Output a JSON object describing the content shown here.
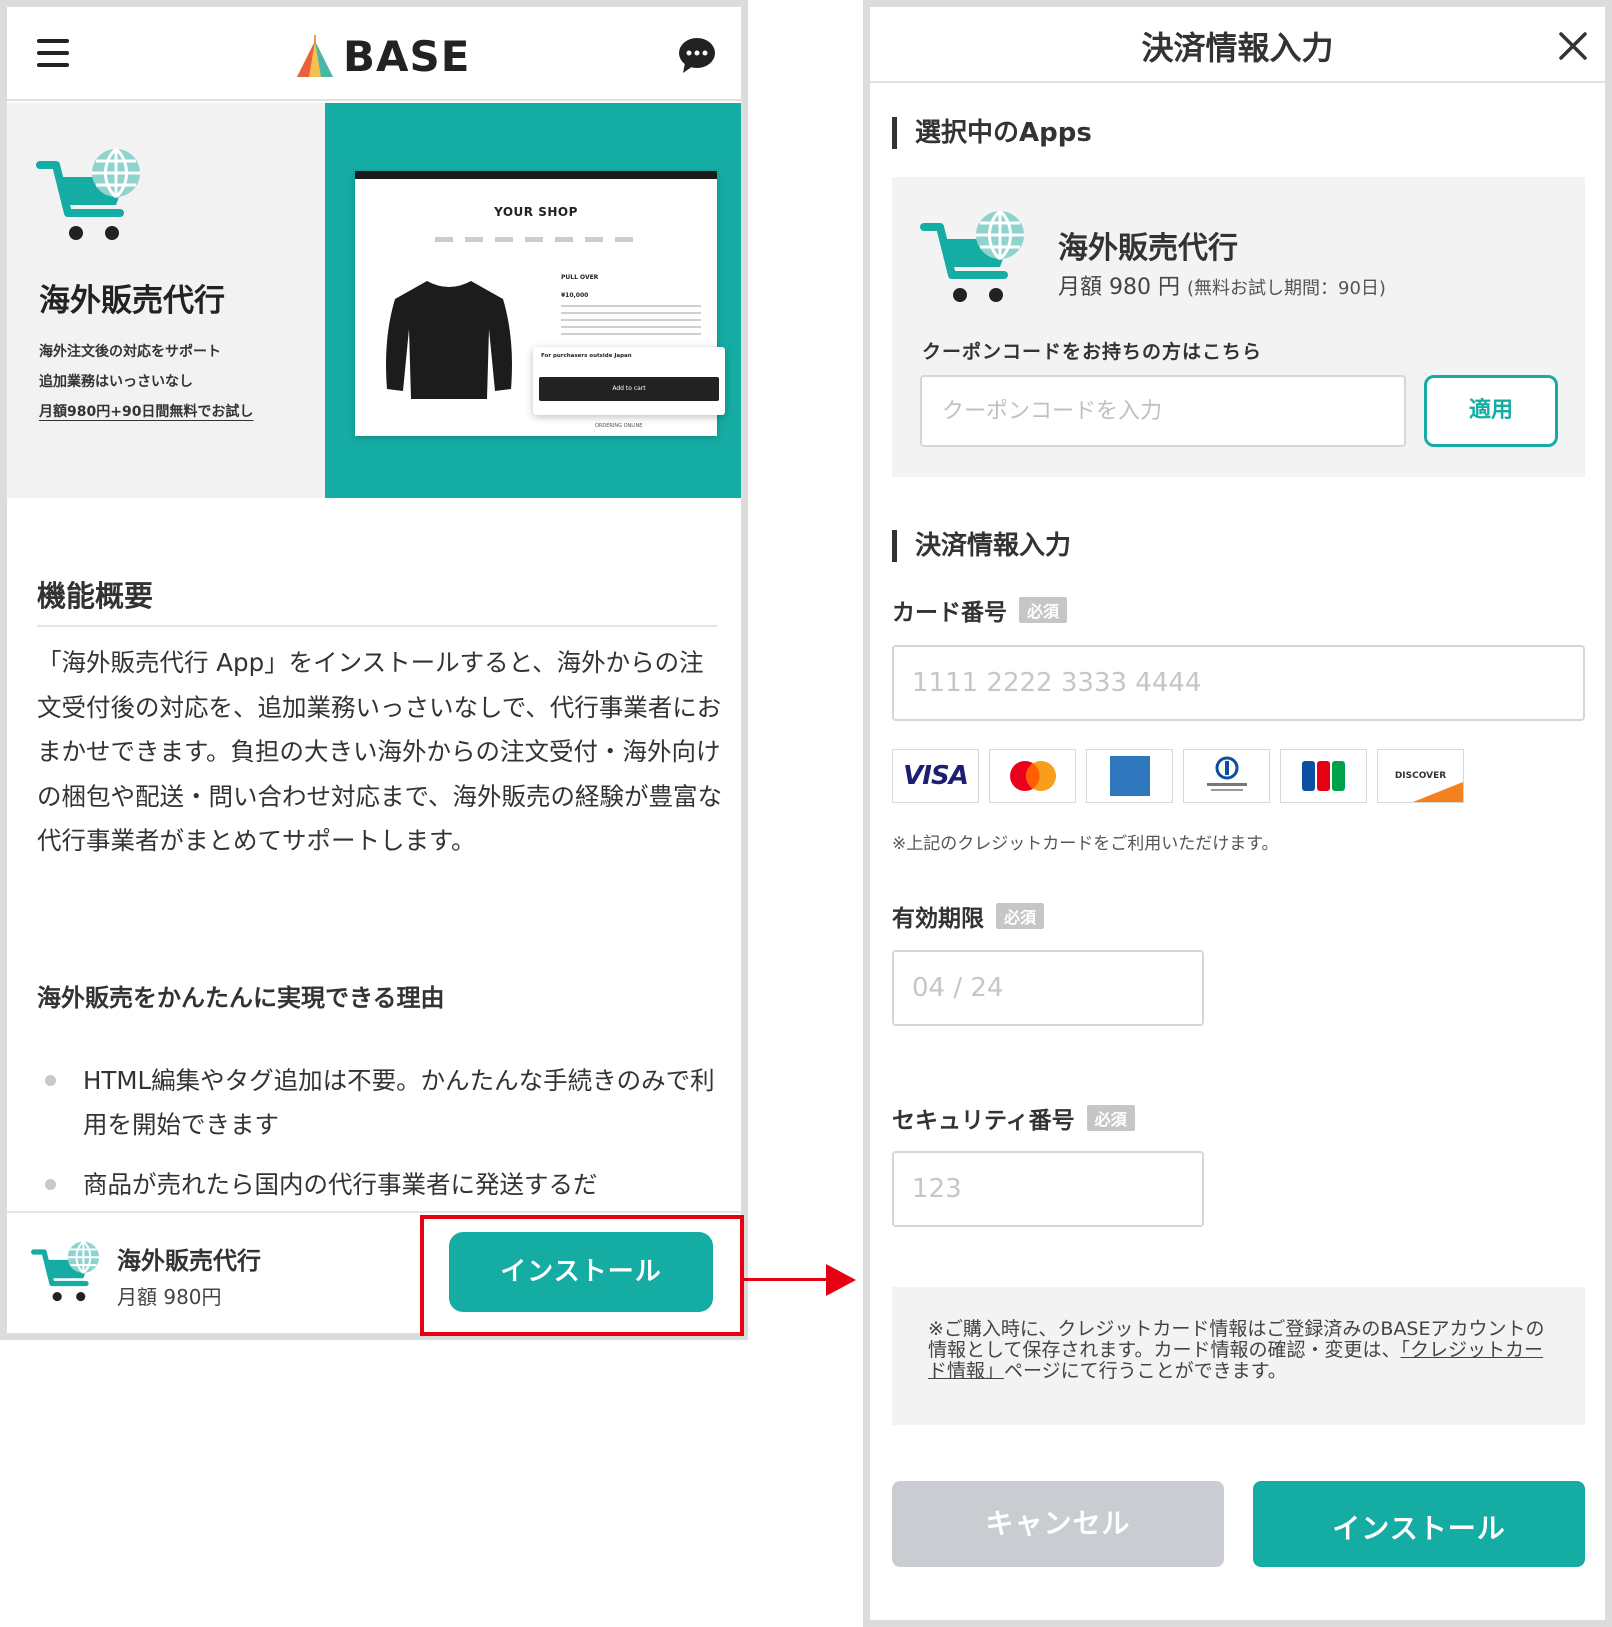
{
  "left": {
    "header": {
      "logo": "BASE"
    },
    "hero": {
      "title": "海外販売代行",
      "features": [
        "海外注文後の対応をサポート",
        "追加業務はいっさいなし",
        "月額980円+90日間無料でお試し"
      ],
      "shop": {
        "title": "YOUR SHOP",
        "product_name": "PULL OVER",
        "product_price": "¥10,000",
        "overseas_label": "For purchasers outside Japan",
        "add_cart": "Add to cart",
        "footer_text": "ORDERING ONLINE"
      }
    },
    "section": {
      "title": "機能概要",
      "description": "「海外販売代行 App」をインストールすると、海外からの注文受付後の対応を、追加業務いっさいなしで、代行事業者におまかせできます。負担の大きい海外からの注文受付・海外向けの梱包や配送・問い合わせ対応まで、海外販売の経験が豊富な代行事業者がまとめてサポートします。"
    },
    "reasons": {
      "title": "海外販売をかんたんに実現できる理由",
      "items": [
        "HTML編集やタグ追加は不要。かんたんな手続きのみで利用を開始できます",
        "商品が売れたら国内の代行事業者に発送するだ"
      ]
    },
    "bottom_bar": {
      "app_name": "海外販売代行",
      "price": "月額 980円",
      "install": "インストール"
    }
  },
  "modal": {
    "title": "決済情報入力",
    "apps_section": "選択中のApps",
    "app": {
      "name": "海外販売代行",
      "price": "月額 980 円",
      "trial": "(無料お試し期間：90日)"
    },
    "coupon": {
      "label": "クーポンコードをお持ちの方はこちら",
      "placeholder": "クーポンコードを入力",
      "apply": "適用"
    },
    "payment_section": "決済情報入力",
    "required": "必須",
    "card": {
      "label": "カード番号",
      "placeholder": "1111 2222 3333 4444"
    },
    "brands": [
      "VISA",
      "Mastercard",
      "AMERICAN EXPRESS",
      "Diners Club International",
      "JCB",
      "DISCOVER"
    ],
    "card_note": "※上記のクレジットカードをご利用いただけます。",
    "expiry": {
      "label": "有効期限",
      "placeholder": "04 / 24"
    },
    "security": {
      "label": "セキュリティ番号",
      "placeholder": "123"
    },
    "info": {
      "before": "※ご購入時に、クレジットカード情報はご登録済みのBASEアカウントの情報として保存されます。カード情報の確認・変更は、",
      "link": "「クレジットカード情報」",
      "after": "ページにて行うことができます。"
    },
    "cancel": "キャンセル",
    "install": "インストール"
  },
  "colors": {
    "teal": "#15aca4",
    "annotation_red": "#e60012",
    "panel_border": "#dcdcdc"
  },
  "icons": [
    "menu-icon",
    "chat-icon",
    "cart-globe-icon",
    "close-icon"
  ]
}
